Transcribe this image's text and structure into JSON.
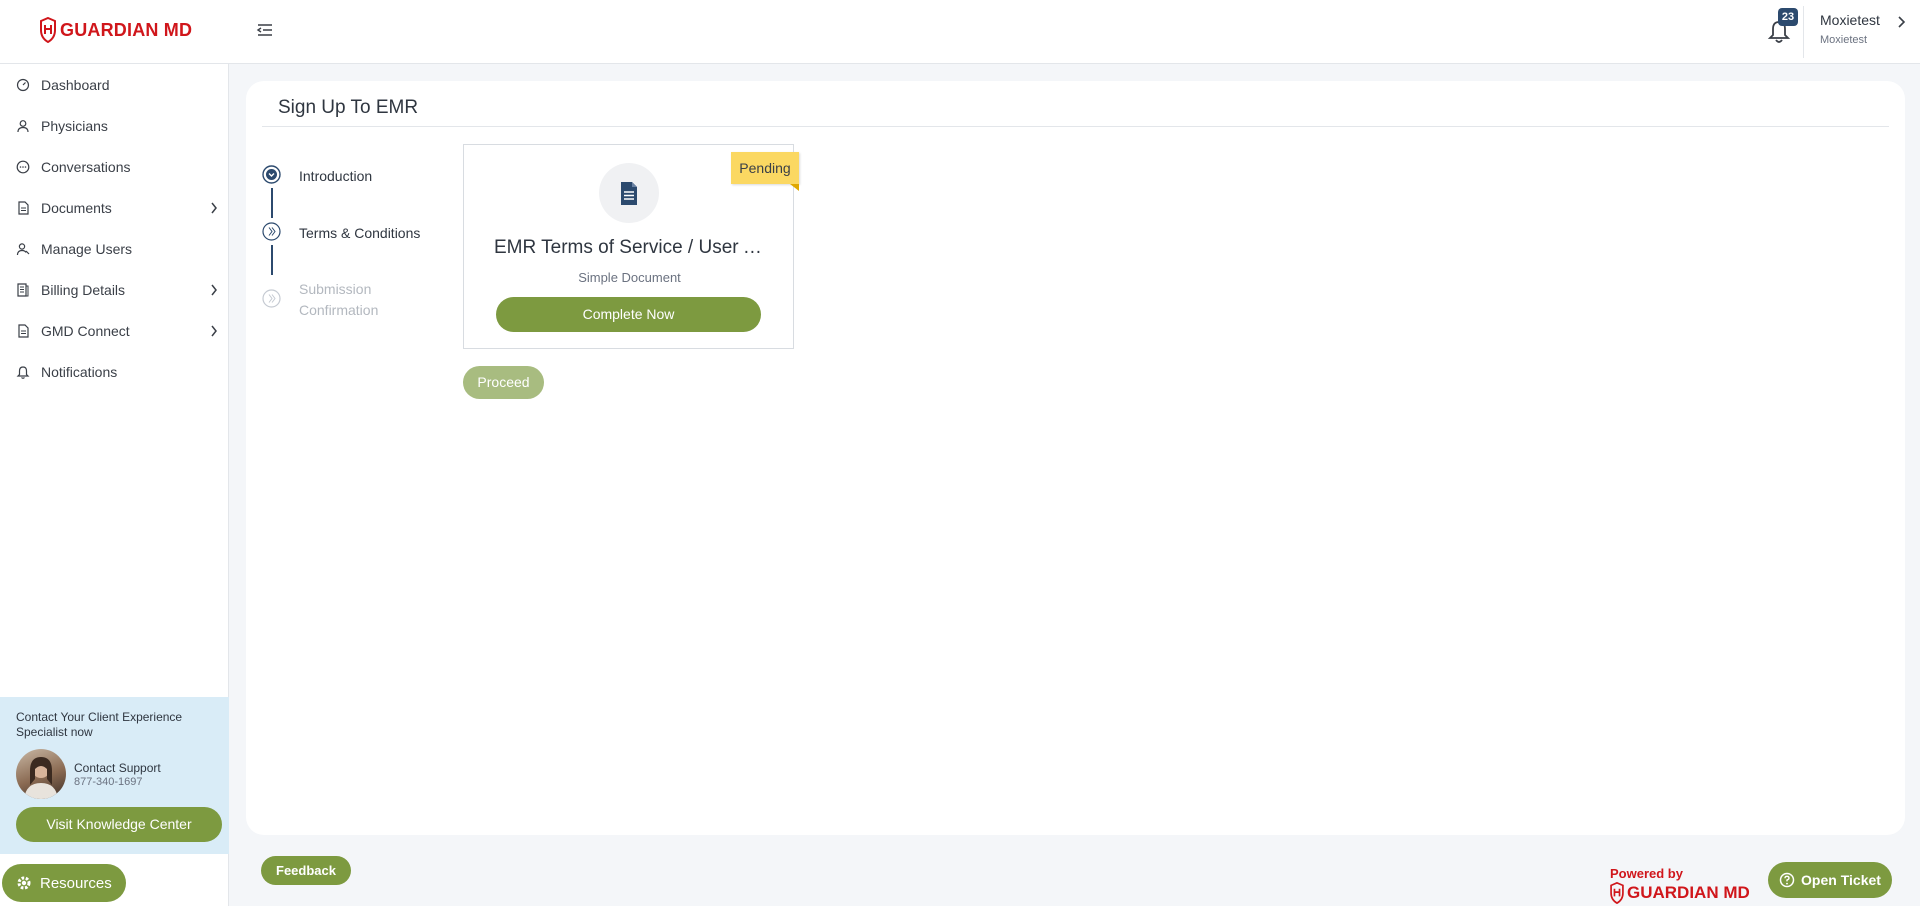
{
  "brand": {
    "name": "GUARDIAN MD",
    "color": "#d0161b"
  },
  "header": {
    "notification_count": "23",
    "user_name": "Moxietest",
    "user_sub": "Moxietest"
  },
  "sidebar": {
    "items": [
      {
        "label": "Dashboard",
        "icon": "dashboard-gauge-icon"
      },
      {
        "label": "Physicians",
        "icon": "person-icon"
      },
      {
        "label": "Conversations",
        "icon": "chat-bubble-icon"
      },
      {
        "label": "Documents",
        "icon": "document-icon",
        "expandable": true
      },
      {
        "label": "Manage Users",
        "icon": "users-icon"
      },
      {
        "label": "Billing Details",
        "icon": "billing-icon",
        "expandable": true
      },
      {
        "label": "GMD Connect",
        "icon": "connect-document-icon",
        "expandable": true
      },
      {
        "label": "Notifications",
        "icon": "bell-icon"
      }
    ]
  },
  "support": {
    "title": "Contact Your Client Experience Specialist now",
    "name": "Contact Support",
    "phone": "877-340-1697",
    "kb_button": "Visit Knowledge Center"
  },
  "resources_label": "Resources",
  "page": {
    "title": "Sign Up To EMR",
    "steps": [
      {
        "label": "Introduction",
        "state": "completed"
      },
      {
        "label": "Terms & Conditions",
        "state": "current"
      },
      {
        "label": "Submission Confirmation",
        "state": "upcoming"
      }
    ]
  },
  "document_card": {
    "title": "EMR Terms of Service / User Agreement",
    "subtitle": "Simple Document",
    "button": "Complete Now",
    "status": "Pending"
  },
  "proceed_label": "Proceed",
  "footer": {
    "feedback": "Feedback",
    "powered_by": "Powered by",
    "open_ticket": "Open Ticket"
  },
  "colors": {
    "accent_green": "#7d9a40",
    "navy": "#2c4a6e",
    "pending_yellow": "#fbd862"
  }
}
